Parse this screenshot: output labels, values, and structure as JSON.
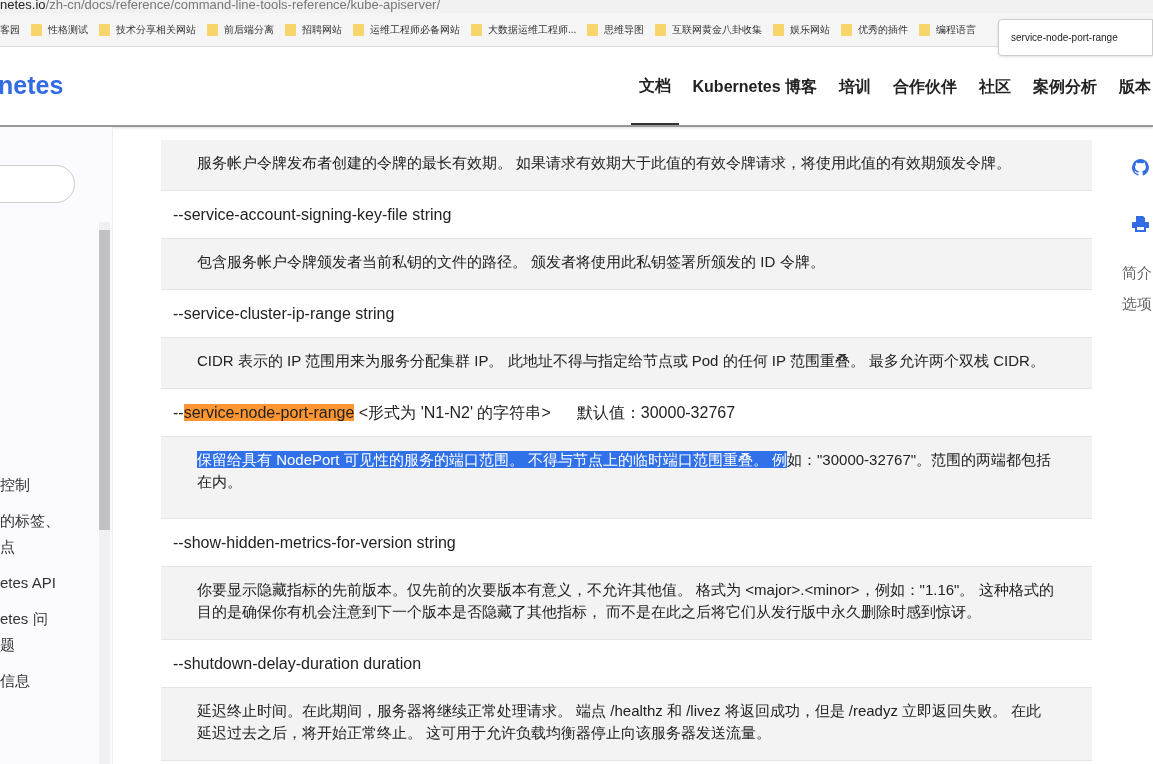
{
  "address_bar": {
    "host": "netes.io",
    "path": "/zh-cn/docs/reference/command-line-tools-reference/kube-apiserver/"
  },
  "bookmarks": [
    "客园",
    "性格测试",
    "技术分享相关网站",
    "前后端分离",
    "招聘网站",
    "运维工程师必备网站",
    "大数据运维工程师...",
    "思维导图",
    "互联网黄金八卦收集",
    "娱乐网站",
    "优秀的插件",
    "编程语言"
  ],
  "find_bar": {
    "value": "service-node-port-range"
  },
  "header": {
    "logo": "netes",
    "nav": [
      {
        "label": "文档",
        "selected": true
      },
      {
        "label": "Kubernetes 博客",
        "selected": false
      },
      {
        "label": "培训",
        "selected": false
      },
      {
        "label": "合作伙伴",
        "selected": false
      },
      {
        "label": "社区",
        "selected": false
      },
      {
        "label": "案例分析",
        "selected": false
      },
      {
        "label": "版本",
        "selected": false
      }
    ]
  },
  "sidebar": {
    "items": [
      {
        "text": "控制"
      },
      {
        "text": "的标签、点"
      },
      {
        "text": "etes API"
      },
      {
        "text": "etes 问题"
      },
      {
        "text": "信息"
      }
    ]
  },
  "options": [
    {
      "kind": "description",
      "parts": [
        {
          "text": "服务帐户令牌发布者创建的令牌的最长有效期。 如果请求有效期大于此值的有效令牌请求，将使用此值的有效期颁发令牌。",
          "selected": false
        }
      ]
    },
    {
      "kind": "flag",
      "parts": [
        {
          "text": "--service-account-signing-key-file string",
          "match": false
        }
      ]
    },
    {
      "kind": "description",
      "parts": [
        {
          "text": "包含服务帐户令牌颁发者当前私钥的文件的路径。 颁发者将使用此私钥签署所颁发的 ID 令牌。",
          "selected": false
        }
      ]
    },
    {
      "kind": "flag",
      "parts": [
        {
          "text": "--service-cluster-ip-range string",
          "match": false
        }
      ]
    },
    {
      "kind": "description",
      "parts": [
        {
          "text": "CIDR 表示的 IP 范围用来为服务分配集群 IP。 此地址不得与指定给节点或 Pod 的任何 IP 范围重叠。 最多允许两个双栈 CIDR。",
          "selected": false
        }
      ]
    },
    {
      "kind": "flag",
      "parts": [
        {
          "text": "--",
          "match": false
        },
        {
          "text": "service-node-port-range",
          "match": true
        },
        {
          "text": " <形式为 'N1-N2' 的字符串>",
          "match": false
        }
      ],
      "default": "默认值：30000-32767"
    },
    {
      "kind": "description",
      "parts": [
        {
          "text": "保留给具有 NodePort 可见性的服务的端口范围。 不得与节点上的临时端口范围重叠。 例",
          "selected": true
        },
        {
          "text": "如：\"30000-32767\"。范围的两端都包括在内。",
          "selected": false
        }
      ]
    },
    {
      "kind": "flag",
      "parts": [
        {
          "text": "--show-hidden-metrics-for-version string",
          "match": false
        }
      ]
    },
    {
      "kind": "description",
      "parts": [
        {
          "text": "你要显示隐藏指标的先前版本。仅先前的次要版本有意义，不允许其他值。 格式为 <major>.<minor>，例如：\"1.16\"。 这种格式的目的是确保你有机会注意到下一个版本是否隐藏了其他指标， 而不是在此之后将它们从发行版中永久删除时感到惊讶。",
          "selected": false
        }
      ]
    },
    {
      "kind": "flag",
      "parts": [
        {
          "text": "--shutdown-delay-duration duration",
          "match": false
        }
      ]
    },
    {
      "kind": "description",
      "parts": [
        {
          "text": "延迟终止时间。在此期间，服务器将继续正常处理请求。 端点 /healthz 和 /livez 将返回成功，但是 /readyz 立即返回失败。 在此延迟过去之后，将开始正常终止。 这可用于允许负载均衡器停止向该服务器发送流量。",
          "selected": false
        }
      ]
    }
  ],
  "toc": [
    "简介",
    "选项"
  ]
}
